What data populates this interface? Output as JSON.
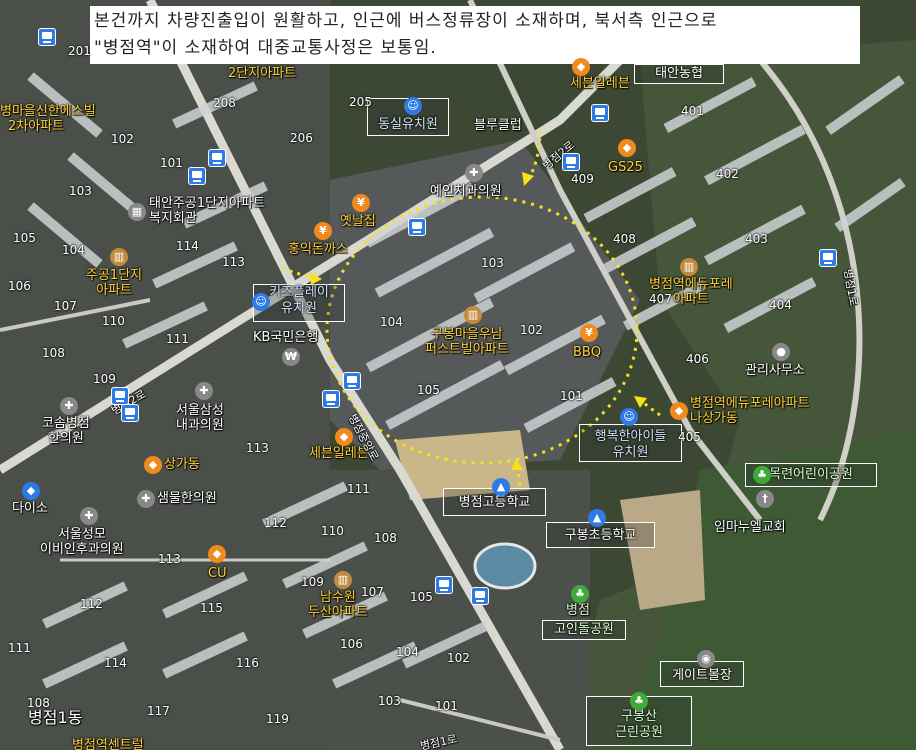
{
  "caption": {
    "line1": "본건까지 차량진출입이 원활하고, 인근에 버스정류장이 소재하며, 북서측 인근으로",
    "line2": "\"병점역\"이 소재하여 대중교통사정은 보통임."
  },
  "boxed_labels": {
    "dongsil": "동실유치원",
    "kidsplay_1": "키즈플레이",
    "kidsplay_2": "유치원",
    "haengbok_1": "행복한아이들",
    "haengbok_2": "유치원",
    "byeongjeom_high": "병점고등학교",
    "gubong_elem": "구봉초등학교",
    "goindol_park": "고인돌공원",
    "mokryeon_park": "목련어린이공원",
    "gatebowl": "게이트볼장",
    "gubongsan_1": "구봉산",
    "gubongsan_2": "근린공원",
    "taean_nonghyup": "태안농협"
  },
  "places": {
    "seven_eleven_top": "세븐일레븐",
    "gs25": "GS25",
    "blue_club": "블루클럽",
    "yein_dental": "예인치과의원",
    "yetnalzip": "옛날집",
    "hongik_donkatsu": "홍익돈까스",
    "taean_welfare_1": "태안주공1단지아파트",
    "taean_welfare_2": "복지회관",
    "jugong_1": "주공1단지",
    "jugong_2": "아파트",
    "kb_bank": "KB국민은행",
    "gubong_apt_1": "구봉마을우남",
    "gubong_apt_2": "퍼스트빌아파트",
    "bbq": "BBQ",
    "edu_apt_1": "병점역에듀포레",
    "edu_apt_2": "아파트",
    "management": "관리사무소",
    "edu_shop_1": "병점역에듀포레아파트",
    "edu_shop_2": "나상가동",
    "seoul_clinic_1": "서울삼성",
    "seoul_clinic_2": "내과의원",
    "cosmo_1": "코솜병점",
    "cosmo_2": "한의원",
    "sangga": "상가동",
    "seven_eleven_mid": "세븐일레븐",
    "saemmul": "샘물한의원",
    "daiso": "다이소",
    "seoul_ent_1": "서울성모",
    "seoul_ent_2": "이비인후과의원",
    "cu": "CU",
    "namsuwon_1": "남수원",
    "namsuwon_2": "두산아파트",
    "byeongjeom_1": "병점",
    "imanuel": "임마누엘교회",
    "byeongjeom_1dong": "병점1동",
    "danji_2": "2단지아파트",
    "shinhan_1": "병마을신한에스빌",
    "shinhan_2": "2차아파트",
    "byeongjeom_bottom": "병점역센트럴"
  },
  "roads": {
    "byeongjeom_ro_a": "병점2로",
    "byeongjeom_ro_b": "병점1로",
    "byeongjeom_jungang": "병점중앙로",
    "byeongjeom_1ro_bottom": "병점1로",
    "left_ro": "병점2로"
  },
  "building_numbers": [
    "201",
    "208",
    "205",
    "206",
    "102",
    "101",
    "103",
    "105",
    "104",
    "114",
    "113",
    "106",
    "107",
    "110",
    "111",
    "108",
    "109",
    "103",
    "104",
    "102",
    "105",
    "101",
    "401",
    "409",
    "402",
    "408",
    "403",
    "407",
    "404",
    "406",
    "405",
    "113",
    "111",
    "112",
    "110",
    "108",
    "113",
    "112",
    "114",
    "109",
    "107",
    "115",
    "106",
    "104",
    "102",
    "116",
    "117",
    "103",
    "101",
    "119",
    "105",
    "108",
    "111"
  ],
  "colors": {
    "caption_bg": "#ffffff",
    "route_dots": "#f5e21a",
    "bus_stop": "#2f7be5",
    "school_icon": "#2f7be5",
    "park_icon": "#3fa93a",
    "food_icon": "#f08a1c",
    "apt_icon": "#c28a3c",
    "clinic_icon": "#8a8a8a"
  },
  "icons": {
    "bus": "bus-stop-icon",
    "school": "school-icon",
    "park": "tree-icon",
    "food": "restaurant-icon",
    "shop": "shopping-bag-icon",
    "apt": "apartment-icon",
    "clinic": "cross-icon",
    "bank": "bank-icon",
    "kindergarten": "smiley-icon"
  }
}
